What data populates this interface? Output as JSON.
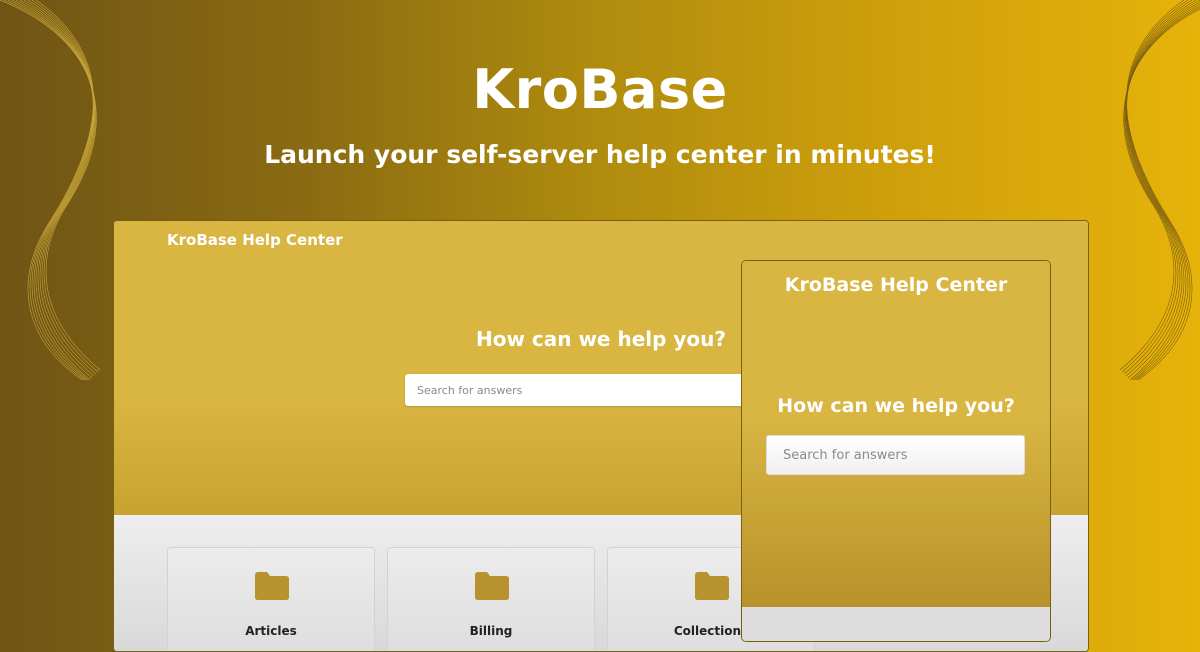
{
  "hero": {
    "title": "KroBase",
    "subtitle": "Launch your self-server help center in minutes!"
  },
  "desktop_preview": {
    "brand": "KroBase Help Center",
    "heading": "How can we help you?",
    "search_placeholder": "Search for answers",
    "cards": [
      {
        "label": "Articles",
        "icon": "folder-icon"
      },
      {
        "label": "Billing",
        "icon": "folder-icon"
      },
      {
        "label": "Collections",
        "icon": "folder-icon"
      }
    ]
  },
  "mobile_preview": {
    "brand": "KroBase Help Center",
    "heading": "How can we help you?",
    "search_placeholder": "Search for answers"
  },
  "colors": {
    "background_start": "#6e5515",
    "background_end": "#e6b30a",
    "hero_gold": "#d9b542",
    "folder": "#b8922e",
    "text_white": "#ffffff"
  }
}
